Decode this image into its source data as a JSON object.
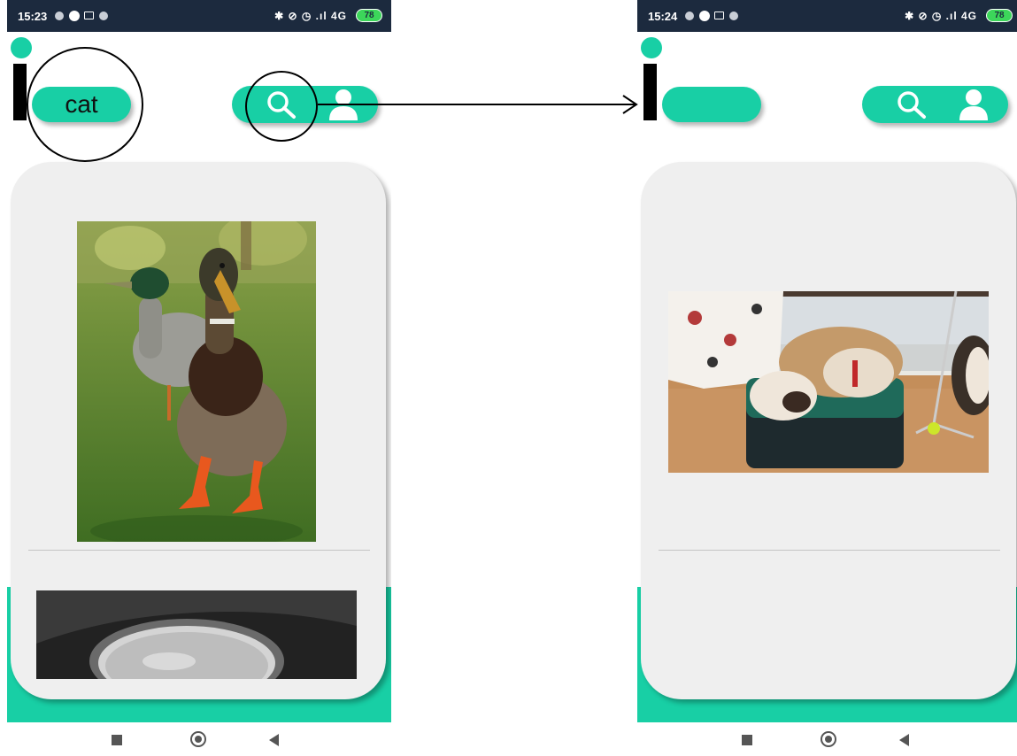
{
  "before": {
    "status": {
      "time": "15:23",
      "right_icons": "✱ ⊘ ◷ .ıl 4G",
      "battery": "78"
    },
    "search": {
      "value": "cat"
    },
    "icons": {
      "search": "search-icon",
      "user": "user-icon"
    },
    "results": [
      {
        "name": "duck-photo",
        "description": "two mallard ducks on grass"
      },
      {
        "name": "bowl-photo",
        "description": "grey bowl partially visible"
      }
    ]
  },
  "after": {
    "status": {
      "time": "15:24",
      "right_icons": "✱ ⊘ ◷ .ıl 4G",
      "battery": "78"
    },
    "search": {
      "value": ""
    },
    "icons": {
      "search": "search-icon",
      "user": "user-icon"
    },
    "results": [
      {
        "name": "cats-photo",
        "description": "two cats curled on an ottoman"
      }
    ]
  },
  "colors": {
    "accent": "#18cfa5",
    "statusbar": "#1c2a3e",
    "card": "#efefef"
  }
}
